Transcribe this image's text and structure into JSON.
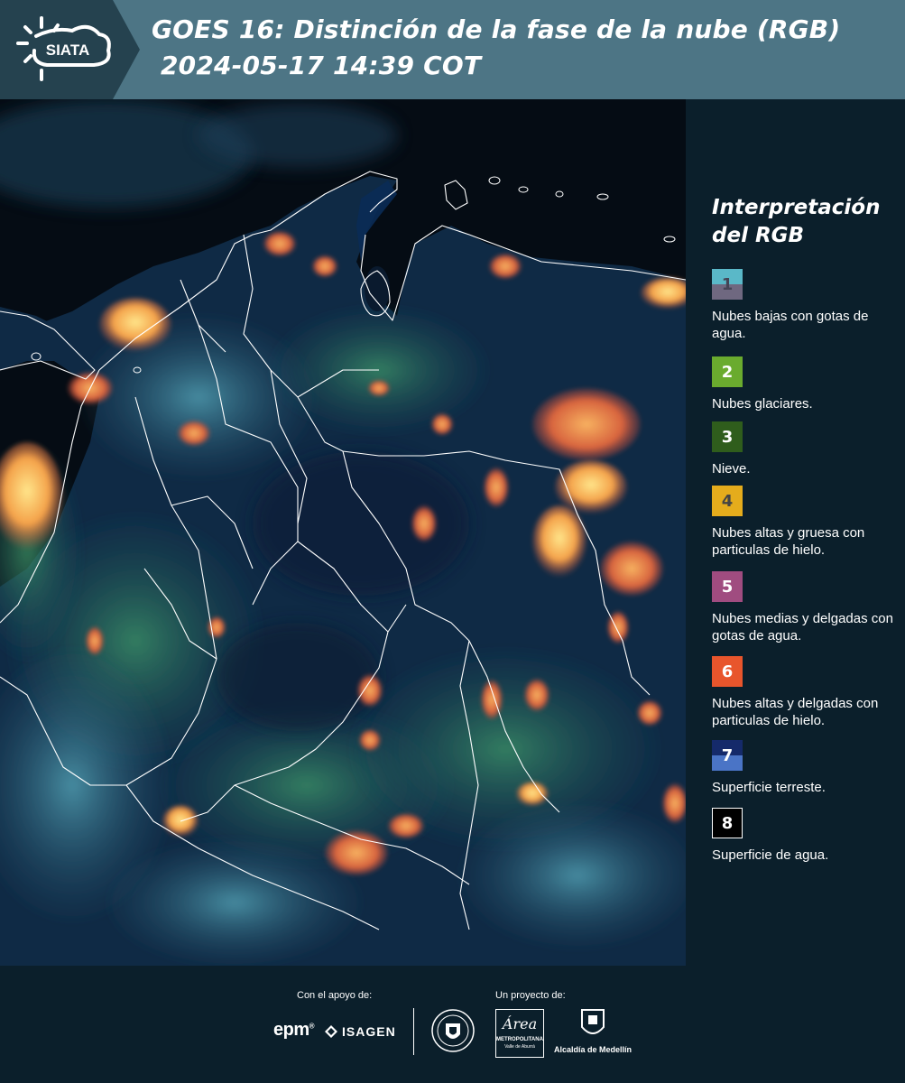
{
  "header": {
    "logo_text": "SIATA",
    "title_line1": "GOES 16: Distinción de la fase de la nube (RGB)",
    "title_line2": "2024-05-17 14:39 COT",
    "bar_color": "#4d7585",
    "logo_color": "#25424f"
  },
  "legend": {
    "title_line1": "Interpretación",
    "title_line2": "del RGB",
    "items": [
      {
        "num": "1",
        "top": "#5ab8c8",
        "bottom": "#6f6880",
        "numcolor": "#444455",
        "label": "Nubes bajas con gotas de agua."
      },
      {
        "num": "2",
        "top": "#6aab2e",
        "bottom": "#6aab2e",
        "numcolor": "#ffffff",
        "label": "Nubes glaciares."
      },
      {
        "num": "3",
        "top": "#2f5d1c",
        "bottom": "#2f5d1c",
        "numcolor": "#ffffff",
        "label": "Nieve."
      },
      {
        "num": "4",
        "top": "#e5ac1c",
        "bottom": "#e5ac1c",
        "numcolor": "#444444",
        "label": "Nubes altas y gruesa con particulas de hielo."
      },
      {
        "num": "5",
        "top": "#a04c80",
        "bottom": "#a04c80",
        "numcolor": "#ffffff",
        "label": "Nubes medias y delgadas con gotas de agua."
      },
      {
        "num": "6",
        "top": "#e8552c",
        "bottom": "#e8552c",
        "numcolor": "#ffffff",
        "label": "Nubes altas y delgadas con particulas de hielo."
      },
      {
        "num": "7",
        "top": "#152a6a",
        "bottom": "#4a74c6",
        "numcolor": "#ffffff",
        "label": "Superficie terreste."
      },
      {
        "num": "8",
        "top": "#000000",
        "bottom": "#000000",
        "numcolor": "#ffffff",
        "label": "Superficie de agua."
      }
    ]
  },
  "footer": {
    "support_label": "Con el apoyo de:",
    "project_label": "Un proyecto de:",
    "epm": "epm",
    "isagen": "ISAGEN",
    "area_script": "Área",
    "area_line1": "METROPOLITANA",
    "area_line2": "Valle de Aburrá",
    "alcaldia": "Alcaldía de Medellín"
  }
}
